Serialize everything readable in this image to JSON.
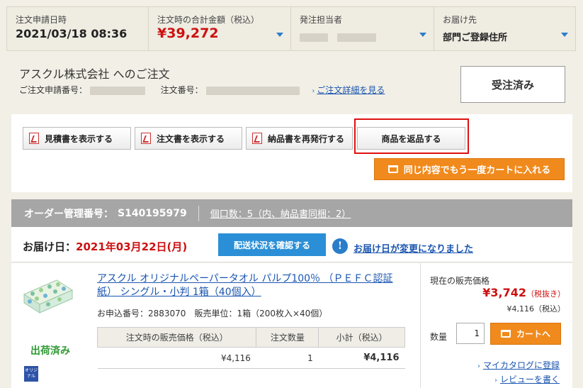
{
  "summary": {
    "date_label": "注文申請日時",
    "date_value": "2021/03/18 08:36",
    "total_label": "注文時の合計金額（税込）",
    "total_value": "¥39,272",
    "orderer_label": "発注担当者",
    "dest_label": "お届け先",
    "dest_value": "部門ご登録住所"
  },
  "company": {
    "name": "アスクル株式会社 へのご注文",
    "request_no_label": "ご注文申請番号：",
    "order_no_label": "注文番号：",
    "detail_link": "ご注文詳細を見る",
    "status": "受注済み"
  },
  "actions": {
    "quote_btn": "見積書を表示する",
    "order_btn": "注文書を表示する",
    "delivery_btn": "納品書を再発行する",
    "return_btn": "商品を返品する",
    "cart_again_btn": "同じ内容でもう一度カートに入れる"
  },
  "order": {
    "mgmt_label": "オーダー管理番号：",
    "mgmt_no": "S140195979",
    "packs": "個口数：5（内、納品書同梱：2）",
    "delivery_label": "お届け日：",
    "delivery_date": "2021年03月22日(月)",
    "track_btn": "配送状況を確認する",
    "date_changed": "お届け日が変更になりました"
  },
  "product": {
    "name": "アスクル オリジナルペーパータオル パルプ100％ （ＰＥＦＣ認証紙） シングル・小判 1箱（40個入）",
    "info": "お申込番号：2883070　販売単位：1箱（200枚入×40個）",
    "status": "出荷済み",
    "badge": "オリジナル",
    "table_headers": [
      "注文時の販売価格（税込）",
      "注文数量",
      "小計（税込）"
    ],
    "table_row": [
      "¥4,116",
      "1",
      "¥4,116"
    ],
    "current_label": "現在の販売価格",
    "current_price": "¥3,742",
    "current_tax": "（税抜き）",
    "incl_price": "¥4,116（税込）",
    "qty_label": "数量",
    "qty_value": "1",
    "cart_btn": "カートへ",
    "mycatalog": "マイカタログに登録",
    "review": "レビューを書く"
  },
  "colors": {
    "accent_orange": "#f18a1c",
    "price_red": "#cc1111",
    "link_blue": "#1a55b0",
    "button_blue": "#2a8fd6",
    "shipped_green": "#2f9a33",
    "highlight_red": "#e01010"
  }
}
